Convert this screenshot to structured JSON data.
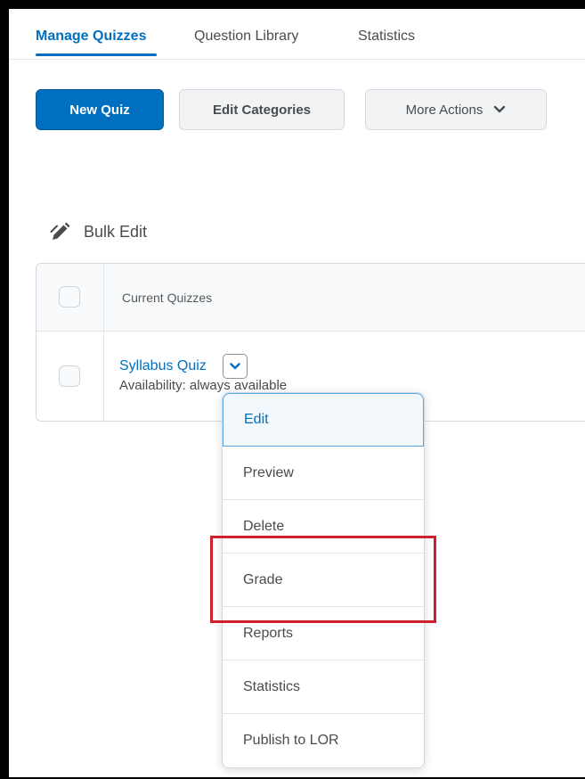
{
  "tabs": [
    {
      "label": "Manage Quizzes",
      "active": true
    },
    {
      "label": "Question Library",
      "active": false
    },
    {
      "label": "Statistics",
      "active": false
    }
  ],
  "toolbar": {
    "new_quiz_label": "New Quiz",
    "edit_categories_label": "Edit Categories",
    "more_actions_label": "More Actions"
  },
  "bulk_edit": {
    "label": "Bulk Edit",
    "icon": "pencil-icon"
  },
  "table": {
    "header": "Current Quizzes",
    "rows": [
      {
        "title": "Syllabus Quiz",
        "availability": "Availability: always available"
      }
    ]
  },
  "context_menu": {
    "items": [
      {
        "label": "Edit"
      },
      {
        "label": "Preview"
      },
      {
        "label": "Delete"
      },
      {
        "label": "Grade"
      },
      {
        "label": "Reports"
      },
      {
        "label": "Statistics"
      },
      {
        "label": "Publish to LOR"
      }
    ]
  },
  "colors": {
    "accent": "#006fbf",
    "highlight_box": "#d0202e"
  }
}
